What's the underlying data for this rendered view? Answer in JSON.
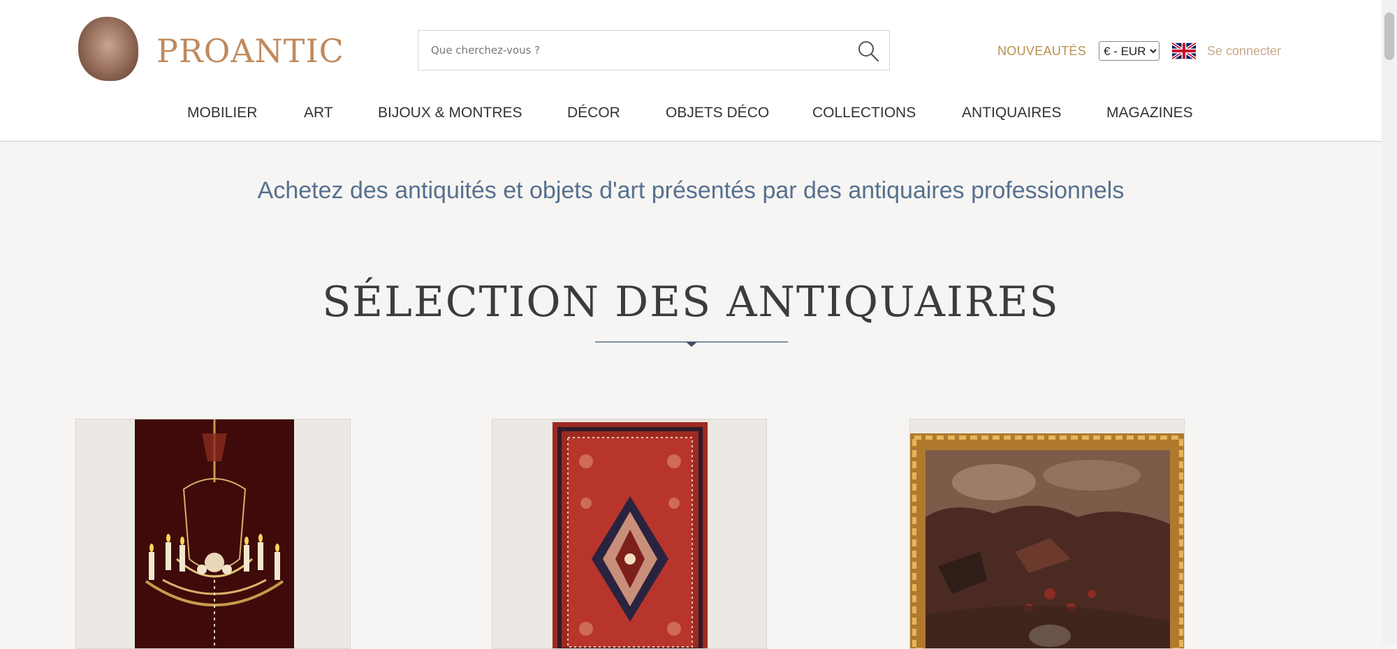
{
  "brand": {
    "name": "PROANTIC"
  },
  "search": {
    "placeholder": "Que cherchez-vous ?",
    "icon": "search-icon"
  },
  "header_right": {
    "new_label": "NOUVEAUTÉS",
    "currency": {
      "selected": "€ - EUR"
    },
    "language_flag": "uk-flag-icon",
    "login_label": "Se connecter"
  },
  "nav": {
    "items": [
      {
        "label": "MOBILIER"
      },
      {
        "label": "ART"
      },
      {
        "label": "BIJOUX & MONTRES"
      },
      {
        "label": "DÉCOR"
      },
      {
        "label": "OBJETS DÉCO"
      },
      {
        "label": "COLLECTIONS"
      },
      {
        "label": "ANTIQUAIRES"
      },
      {
        "label": "MAGAZINES"
      }
    ]
  },
  "main": {
    "tagline": "Achetez des antiquités et objets d'art présentés par des antiquaires professionnels",
    "section_title": "SÉLECTION DES ANTIQUAIRES",
    "products": [
      {
        "image": "chandelier-image"
      },
      {
        "image": "persian-rug-image"
      },
      {
        "image": "framed-painting-image"
      }
    ]
  },
  "colors": {
    "brand": "#c1895c",
    "accent_gold": "#b6904f",
    "tagline_blue": "#56708f",
    "background": "#f6f5f3"
  }
}
